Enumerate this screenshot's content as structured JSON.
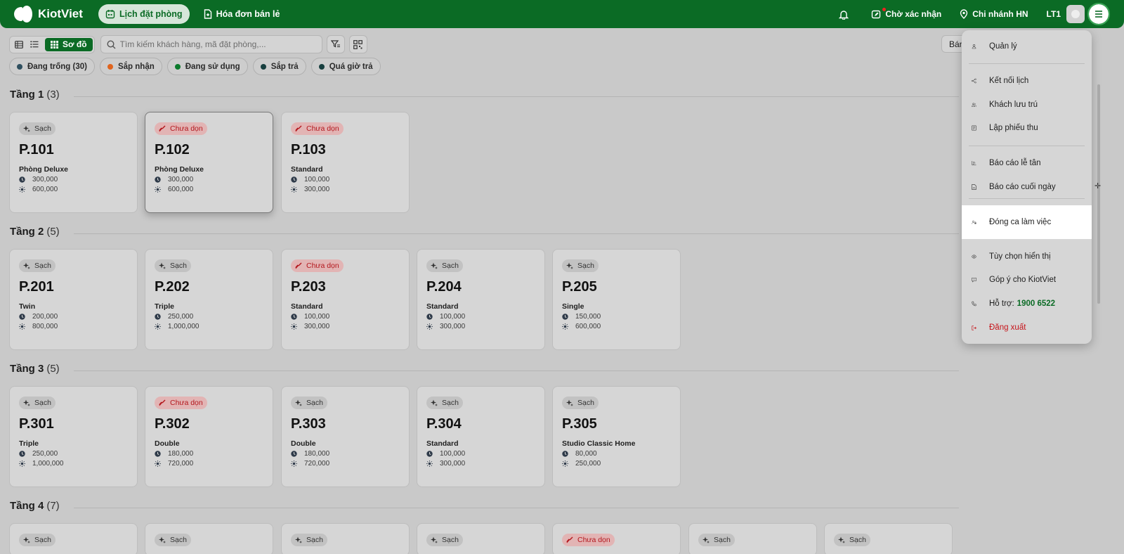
{
  "app": {
    "name": "KiotViet"
  },
  "nav": {
    "tabs": [
      {
        "label": "Lịch đặt phòng"
      },
      {
        "label": "Hóa đơn bán lẻ"
      }
    ],
    "pending": "Chờ xác nhận",
    "branch": "Chi nhánh HN",
    "user": "LT1"
  },
  "toolbar": {
    "view_active": "Sơ đồ",
    "search_placeholder": "Tìm kiếm khách hàng, mã đặt phòng,...",
    "right_button": "Bán"
  },
  "chips": [
    {
      "label": "Đang trống (30)",
      "color": "#2f4f5f"
    },
    {
      "label": "Sắp nhận",
      "color": "#e0641e"
    },
    {
      "label": "Đang sử dụng",
      "color": "#0b7a2c"
    },
    {
      "label": "Sắp trả",
      "color": "#173f3f"
    },
    {
      "label": "Quá giờ trả",
      "color": "#173f3f"
    }
  ],
  "floors": [
    {
      "title": "Tầng 1",
      "count": "(3)",
      "rooms": [
        {
          "name": "P.101",
          "status": "Sạch",
          "type": "Phòng Deluxe",
          "price_hour": "300,000",
          "price_day": "600,000"
        },
        {
          "name": "P.102",
          "status": "Chưa dọn",
          "type": "Phòng Deluxe",
          "price_hour": "300,000",
          "price_day": "600,000"
        },
        {
          "name": "P.103",
          "status": "Chưa dọn",
          "type": "Standard",
          "price_hour": "100,000",
          "price_day": "300,000"
        }
      ]
    },
    {
      "title": "Tầng 2",
      "count": "(5)",
      "rooms": [
        {
          "name": "P.201",
          "status": "Sạch",
          "type": "Twin",
          "price_hour": "200,000",
          "price_day": "800,000"
        },
        {
          "name": "P.202",
          "status": "Sạch",
          "type": "Triple",
          "price_hour": "250,000",
          "price_day": "1,000,000"
        },
        {
          "name": "P.203",
          "status": "Chưa dọn",
          "type": "Standard",
          "price_hour": "100,000",
          "price_day": "300,000"
        },
        {
          "name": "P.204",
          "status": "Sạch",
          "type": "Standard",
          "price_hour": "100,000",
          "price_day": "300,000"
        },
        {
          "name": "P.205",
          "status": "Sạch",
          "type": "Single",
          "price_hour": "150,000",
          "price_day": "600,000"
        }
      ]
    },
    {
      "title": "Tầng 3",
      "count": "(5)",
      "rooms": [
        {
          "name": "P.301",
          "status": "Sạch",
          "type": "Triple",
          "price_hour": "250,000",
          "price_day": "1,000,000"
        },
        {
          "name": "P.302",
          "status": "Chưa dọn",
          "type": "Double",
          "price_hour": "180,000",
          "price_day": "720,000"
        },
        {
          "name": "P.303",
          "status": "Sạch",
          "type": "Double",
          "price_hour": "180,000",
          "price_day": "720,000"
        },
        {
          "name": "P.304",
          "status": "Sạch",
          "type": "Standard",
          "price_hour": "100,000",
          "price_day": "300,000"
        },
        {
          "name": "P.305",
          "status": "Sạch",
          "type": "Studio Classic Home",
          "price_hour": "80,000",
          "price_day": "250,000"
        }
      ]
    },
    {
      "title": "Tầng 4",
      "count": "(7)",
      "rooms": [
        {
          "status": "Sạch"
        },
        {
          "status": "Sạch"
        },
        {
          "status": "Sạch"
        },
        {
          "status": "Sạch"
        },
        {
          "status": "Chưa dọn"
        },
        {
          "status": "Sạch"
        },
        {
          "status": "Sạch"
        }
      ]
    }
  ],
  "menu": {
    "items": [
      {
        "label": "Quản lý",
        "icon": "user-icon"
      },
      {
        "label": "Kết nối lịch",
        "icon": "share-icon"
      },
      {
        "label": "Khách lưu trú",
        "icon": "users-icon"
      },
      {
        "label": "Lập phiếu thu",
        "icon": "receipt-icon"
      },
      {
        "label": "Báo cáo lễ tân",
        "icon": "chart-icon"
      },
      {
        "label": "Báo cáo cuối ngày",
        "icon": "report-icon"
      },
      {
        "label": "Đóng ca làm việc",
        "icon": "user-lock-icon"
      },
      {
        "label": "Tùy chọn hiển thị",
        "icon": "eye-icon"
      },
      {
        "label": "Góp ý cho KiotViet",
        "icon": "feedback-icon"
      },
      {
        "label": "Hỗ trợ:",
        "phone": "1900 6522",
        "icon": "phone-icon"
      },
      {
        "label": "Đăng xuất",
        "icon": "logout-icon"
      }
    ]
  }
}
